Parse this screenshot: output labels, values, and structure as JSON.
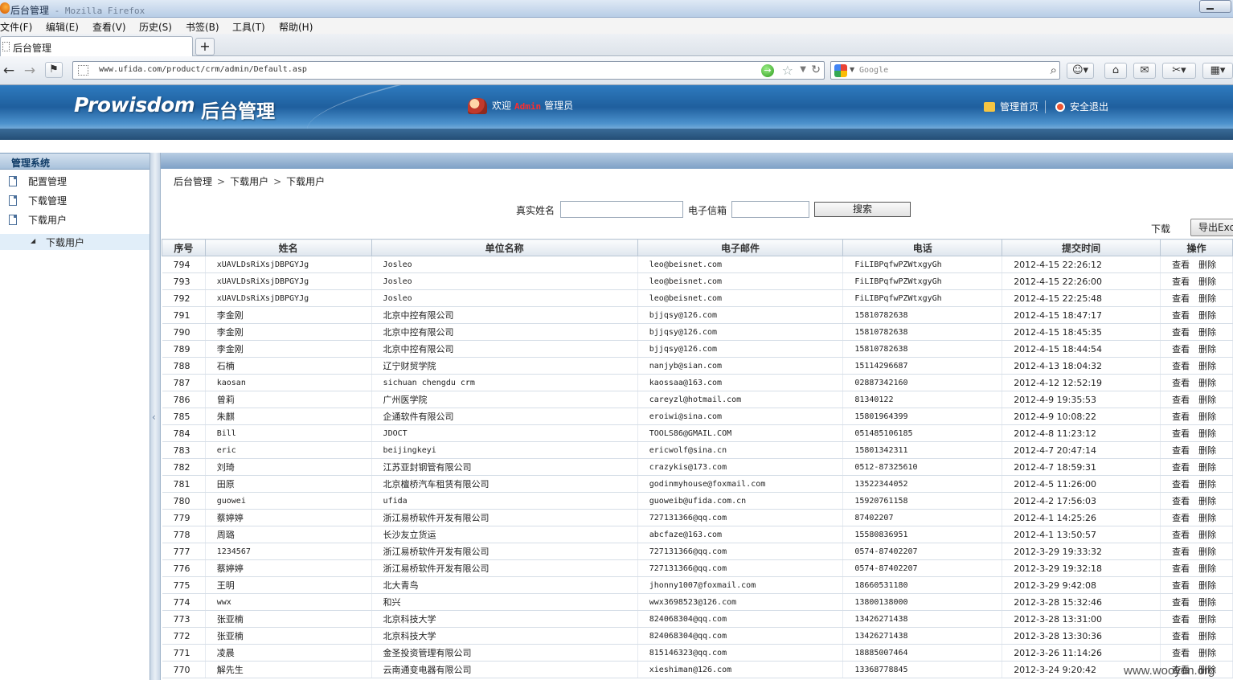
{
  "window": {
    "title": "后台管理",
    "app_suffix": " - Mozilla Firefox"
  },
  "menu": [
    {
      "label": "文件(F)"
    },
    {
      "label": "编辑(E)"
    },
    {
      "label": "查看(V)"
    },
    {
      "label": "历史(S)"
    },
    {
      "label": "书签(B)"
    },
    {
      "label": "工具(T)"
    },
    {
      "label": "帮助(H)"
    }
  ],
  "tab": {
    "label": "后台管理",
    "new_tab": "+"
  },
  "navbar": {
    "url": "www.ufida.com/product/crm/admin/Default.asp",
    "search_placeholder": "Google"
  },
  "header": {
    "logo": "Prowisdom",
    "logo_sub": "后台管理",
    "welcome_prefix": "欢迎",
    "welcome_user": "Admin",
    "welcome_suffix": "管理员",
    "home_link": "管理首页",
    "logout_link": "安全退出"
  },
  "sidebar": {
    "heading": "管理系统",
    "items": [
      {
        "label": "配置管理"
      },
      {
        "label": "下载管理"
      },
      {
        "label": "下载用户"
      }
    ],
    "sub_item": {
      "label": "下载用户"
    }
  },
  "breadcrumb": [
    "后台管理",
    "下载用户",
    "下载用户"
  ],
  "search": {
    "name_label": "真实姓名",
    "name_value": "",
    "email_label": "电子信箱",
    "email_value": "",
    "button": "搜索"
  },
  "download_label": "下载",
  "export_button": "导出Excel",
  "table": {
    "headers": [
      "序号",
      "姓名",
      "单位名称",
      "电子邮件",
      "电话",
      "提交时间",
      "操作"
    ],
    "action_view": "查看",
    "action_delete": "删除",
    "rows": [
      [
        "794",
        "xUAVLDsRiXsjDBPGYJg",
        "Josleo",
        "leo@beisnet.com",
        "FiLIBPqfwPZWtxgyGh",
        "2012-4-15 22:26:12"
      ],
      [
        "793",
        "xUAVLDsRiXsjDBPGYJg",
        "Josleo",
        "leo@beisnet.com",
        "FiLIBPqfwPZWtxgyGh",
        "2012-4-15 22:26:00"
      ],
      [
        "792",
        "xUAVLDsRiXsjDBPGYJg",
        "Josleo",
        "leo@beisnet.com",
        "FiLIBPqfwPZWtxgyGh",
        "2012-4-15 22:25:48"
      ],
      [
        "791",
        "李金刚",
        "北京中控有限公司",
        "bjjqsy@126.com",
        "15810782638",
        "2012-4-15 18:47:17"
      ],
      [
        "790",
        "李金刚",
        "北京中控有限公司",
        "bjjqsy@126.com",
        "15810782638",
        "2012-4-15 18:45:35"
      ],
      [
        "789",
        "李金刚",
        "北京中控有限公司",
        "bjjqsy@126.com",
        "15810782638",
        "2012-4-15 18:44:54"
      ],
      [
        "788",
        "石楠",
        "辽宁财贸学院",
        "nanjyb@sian.com",
        "15114296687",
        "2012-4-13 18:04:32"
      ],
      [
        "787",
        "kaosan",
        "sichuan chengdu crm",
        "kaossaa@163.com",
        "02887342160",
        "2012-4-12 12:52:19"
      ],
      [
        "786",
        "曾莉",
        "广州医学院",
        "careyzl@hotmail.com",
        "81340122",
        "2012-4-9 19:35:53"
      ],
      [
        "785",
        "朱麒",
        "企通软件有限公司",
        "eroiwi@sina.com",
        "15801964399",
        "2012-4-9 10:08:22"
      ],
      [
        "784",
        "Bill",
        "JDOCT",
        "TOOLS86@GMAIL.COM",
        "051485106185",
        "2012-4-8 11:23:12"
      ],
      [
        "783",
        "eric",
        "beijingkeyi",
        "ericwolf@sina.cn",
        "15801342311",
        "2012-4-7 20:47:14"
      ],
      [
        "782",
        "刘琦",
        "江苏亚封钢管有限公司",
        "crazykis@173.com",
        "0512-87325610",
        "2012-4-7 18:59:31"
      ],
      [
        "781",
        "田原",
        "北京檀桥汽车租赁有限公司",
        "godinmyhouse@foxmail.com",
        "13522344052",
        "2012-4-5 11:26:00"
      ],
      [
        "780",
        "guowei",
        "ufida",
        "guoweib@ufida.com.cn",
        "15920761158",
        "2012-4-2 17:56:03"
      ],
      [
        "779",
        "蔡婷婷",
        "浙江易桥软件开发有限公司",
        "727131366@qq.com",
        "87402207",
        "2012-4-1 14:25:26"
      ],
      [
        "778",
        "周璐",
        "长沙友立货运",
        "abcfaze@163.com",
        "15580836951",
        "2012-4-1 13:50:57"
      ],
      [
        "777",
        "1234567",
        "浙江易桥软件开发有限公司",
        "727131366@qq.com",
        "0574-87402207",
        "2012-3-29 19:33:32"
      ],
      [
        "776",
        "蔡婷婷",
        "浙江易桥软件开发有限公司",
        "727131366@qq.com",
        "0574-87402207",
        "2012-3-29 19:32:18"
      ],
      [
        "775",
        "王明",
        "北大青鸟",
        "jhonny1007@foxmail.com",
        "18660531180",
        "2012-3-29 9:42:08"
      ],
      [
        "774",
        "wwx",
        "和兴",
        "wwx3698523@126.com",
        "13800138000",
        "2012-3-28 15:32:46"
      ],
      [
        "773",
        "张亚楠",
        "北京科技大学",
        "824068304@qq.com",
        "13426271438",
        "2012-3-28 13:31:00"
      ],
      [
        "772",
        "张亚楠",
        "北京科技大学",
        "824068304@qq.com",
        "13426271438",
        "2012-3-28 13:30:36"
      ],
      [
        "771",
        "凌晨",
        "金圣投资管理有限公司",
        "815146323@qq.com",
        "18885007464",
        "2012-3-26 11:14:26"
      ],
      [
        "770",
        "解先生",
        "云南通变电器有限公司",
        "xieshiman@126.com",
        "13368778845",
        "2012-3-24 9:20:42"
      ]
    ]
  },
  "watermark": "www.wooyun.org"
}
